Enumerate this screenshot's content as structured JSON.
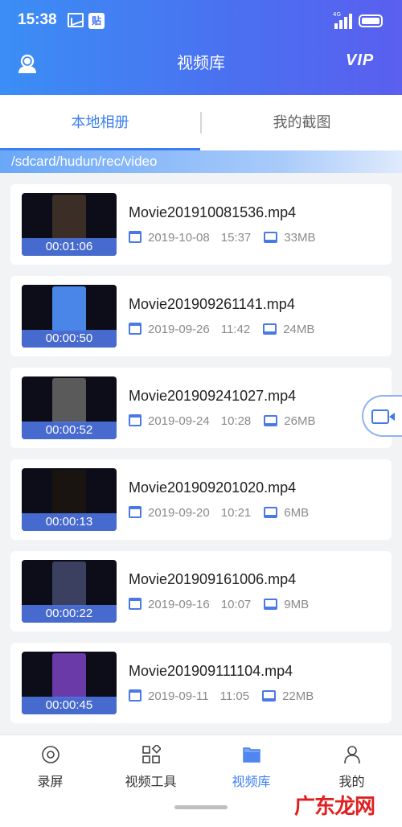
{
  "status_bar": {
    "time": "15:38",
    "paste_icon_text": "贴",
    "signal_label": "4G"
  },
  "nav": {
    "title": "视频库",
    "vip_label": "VIP"
  },
  "tabs": [
    {
      "label": "本地相册",
      "active": true
    },
    {
      "label": "我的截图",
      "active": false
    }
  ],
  "path": "/sdcard/hudun/rec/video",
  "videos": [
    {
      "name": "Movie201910081536.mp4",
      "date": "2019-10-08",
      "time": "15:37",
      "size": "33MB",
      "duration": "00:01:06",
      "thumb_color": "#3a2e26"
    },
    {
      "name": "Movie201909261141.mp4",
      "date": "2019-09-26",
      "time": "11:42",
      "size": "24MB",
      "duration": "00:00:50",
      "thumb_color": "#4a86e8"
    },
    {
      "name": "Movie201909241027.mp4",
      "date": "2019-09-24",
      "time": "10:28",
      "size": "26MB",
      "duration": "00:00:52",
      "thumb_color": "#5a5a5a"
    },
    {
      "name": "Movie201909201020.mp4",
      "date": "2019-09-20",
      "time": "10:21",
      "size": "6MB",
      "duration": "00:00:13",
      "thumb_color": "#1a1410"
    },
    {
      "name": "Movie201909161006.mp4",
      "date": "2019-09-16",
      "time": "10:07",
      "size": "9MB",
      "duration": "00:00:22",
      "thumb_color": "#3c4060"
    },
    {
      "name": "Movie201909111104.mp4",
      "date": "2019-09-11",
      "time": "11:05",
      "size": "22MB",
      "duration": "00:00:45",
      "thumb_color": "#6a3aa8"
    }
  ],
  "bottom_nav": [
    {
      "label": "录屏",
      "icon": "record-icon",
      "active": false
    },
    {
      "label": "视频工具",
      "icon": "tools-icon",
      "active": false
    },
    {
      "label": "视频库",
      "icon": "folder-icon",
      "active": true
    },
    {
      "label": "我的",
      "icon": "person-icon",
      "active": false
    }
  ],
  "watermark": "广东龙网",
  "colors": {
    "accent": "#3c7ff0",
    "header_start": "#3b8ef5",
    "header_end": "#5a5fef",
    "duration_bg": "#4e74e2"
  }
}
